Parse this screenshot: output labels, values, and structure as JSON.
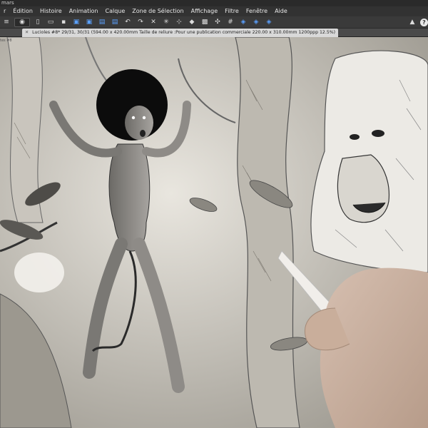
{
  "window": {
    "title": "mars"
  },
  "menu": [
    "r",
    "Édition",
    "Histoire",
    "Animation",
    "Calque",
    "Zone de Sélection",
    "Affichage",
    "Filtre",
    "Fenêtre",
    "Aide"
  ],
  "document_tab": {
    "label": "Lucioles #8* 29/31, 30/31 (594.00 x 420.00mm Taille de reliure :Pour une publication commerciale 220.00 x 310.00mm 1200ppp 12.5%)"
  },
  "side_label": "tes #8",
  "icons": [
    "eye-icon",
    "new-file-icon",
    "open-folder-icon",
    "save-icon",
    "export-icon",
    "undo-icon",
    "redo-icon",
    "eraser-icon",
    "grid-icon",
    "help-icon"
  ]
}
